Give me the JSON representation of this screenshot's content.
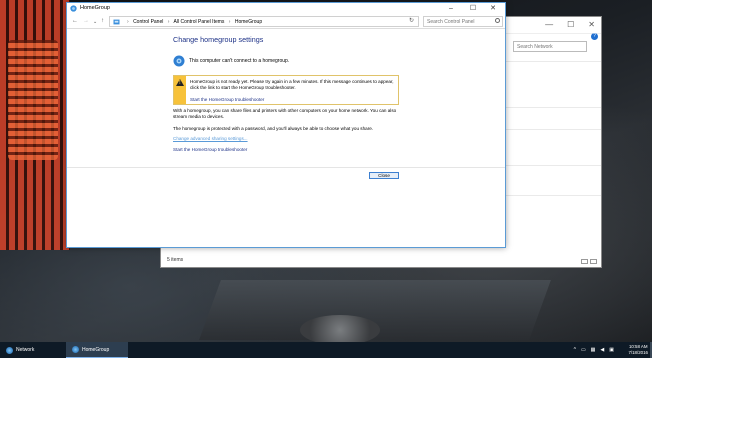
{
  "bg_window": {
    "search_placeholder": "Search Network",
    "status": "5 items"
  },
  "window": {
    "title": "HomeGroup",
    "breadcrumbs": [
      "Control Panel",
      "All Control Panel Items",
      "HomeGroup"
    ],
    "search_placeholder": "Search Control Panel",
    "heading": "Change homegroup settings",
    "status_line": "This computer can't connect to a homegroup.",
    "warning_text": "HomeGroup is not ready yet. Please try again in a few minutes. If this message continues to appear, click the link to start the HomeGroup troubleshooter.",
    "warning_link": "Start the HomeGroup troubleshooter",
    "paragraph1": "With a homegroup, you can share files and printers with other computers on your home network. You can also stream media to devices.",
    "paragraph2": "The homegroup is protected with a password, and you'll always be able to choose what you share.",
    "link_sharing": "Change advanced sharing settings...",
    "link_troubleshooter": "Start the HomeGroup troubleshooter",
    "close_label": "Close"
  },
  "taskbar": {
    "items": [
      {
        "label": "Network"
      },
      {
        "label": "HomeGroup"
      }
    ],
    "time": "10:58 AM",
    "date": "7/18/2016"
  },
  "colors": {
    "accent": "#1e3287",
    "link_light": "#5a9ad8",
    "warning": "#f7c23a",
    "taskbar": "#0e1a26"
  }
}
